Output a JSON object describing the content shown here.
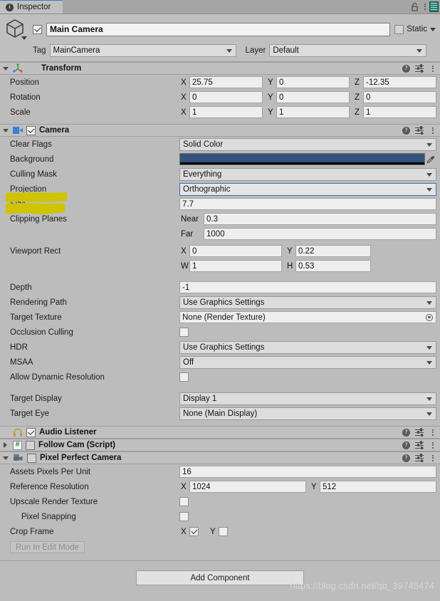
{
  "window": {
    "tab_label": "Inspector",
    "tab_icon": "info-icon",
    "lock_icon": "lock-icon",
    "menu_icon": "kebab-menu-icon",
    "layers_icon": "layers-icon"
  },
  "gameobject": {
    "icon": "cube-icon",
    "enabled": true,
    "name": "Main Camera",
    "static_label": "Static",
    "static_checked": false,
    "tag_label": "Tag",
    "tag_value": "MainCamera",
    "layer_label": "Layer",
    "layer_value": "Default"
  },
  "components": [
    {
      "title": "Transform",
      "icon": "transform-axis-icon",
      "expanded": true,
      "has_toggle": false,
      "help_icon": "help-icon",
      "preset_icon": "preset-settings-icon",
      "menu_icon": "kebab-menu-icon",
      "rows": [
        {
          "name": "Position",
          "x": "25.75",
          "y": "0",
          "z": "-12.35"
        },
        {
          "name": "Rotation",
          "x": "0",
          "y": "0",
          "z": "0"
        },
        {
          "name": "Scale",
          "x": "1",
          "y": "1",
          "z": "1"
        }
      ],
      "axis_labels": {
        "x": "X",
        "y": "Y",
        "z": "Z"
      }
    },
    {
      "title": "Camera",
      "icon": "camera-icon",
      "expanded": true,
      "has_toggle": true,
      "enabled": true,
      "properties": {
        "clear_flags_label": "Clear Flags",
        "clear_flags_value": "Solid Color",
        "background_label": "Background",
        "background_color": "#34527e",
        "background_alpha_color": "#000000",
        "eyedropper_icon": "eyedropper-icon",
        "culling_mask_label": "Culling Mask",
        "culling_mask_value": "Everything",
        "projection_label": "Projection",
        "projection_value": "Orthographic",
        "size_label": "Size",
        "size_value": "7.7",
        "clipping_planes_label": "Clipping Planes",
        "near_label": "Near",
        "near_value": "0.3",
        "far_label": "Far",
        "far_value": "1000",
        "viewport_rect_label": "Viewport Rect",
        "viewport_x_label": "X",
        "viewport_x_value": "0",
        "viewport_y_label": "Y",
        "viewport_y_value": "0.22",
        "viewport_w_label": "W",
        "viewport_w_value": "1",
        "viewport_h_label": "H",
        "viewport_h_value": "0.53",
        "depth_label": "Depth",
        "depth_value": "-1",
        "rendering_path_label": "Rendering Path",
        "rendering_path_value": "Use Graphics Settings",
        "target_texture_label": "Target Texture",
        "target_texture_value": "None (Render Texture)",
        "target_texture_picker_icon": "object-picker-icon",
        "occlusion_culling_label": "Occlusion Culling",
        "occlusion_culling_checked": false,
        "hdr_label": "HDR",
        "hdr_value": "Use Graphics Settings",
        "msaa_label": "MSAA",
        "msaa_value": "Off",
        "allow_dynamic_resolution_label": "Allow Dynamic Resolution",
        "allow_dynamic_resolution_checked": false,
        "target_display_label": "Target Display",
        "target_display_value": "Display 1",
        "target_eye_label": "Target Eye",
        "target_eye_value": "None (Main Display)"
      }
    },
    {
      "title": "Audio Listener",
      "icon": "headphones-icon",
      "expanded": false,
      "has_toggle": true,
      "enabled": true,
      "show_foldout": false
    },
    {
      "title": "Follow Cam (Script)",
      "icon": "script-icon",
      "icon_glyph": "#",
      "expanded": false,
      "has_toggle": true,
      "enabled": false
    },
    {
      "title": "Pixel Perfect Camera",
      "icon": "pixel-perfect-camera-icon",
      "expanded": true,
      "has_toggle": true,
      "enabled": false,
      "properties": {
        "assets_ppu_label": "Assets Pixels Per Unit",
        "assets_ppu_value": "16",
        "reference_resolution_label": "Reference Resolution",
        "ref_x_label": "X",
        "ref_x_value": "1024",
        "ref_y_label": "Y",
        "ref_y_value": "512",
        "upscale_render_texture_label": "Upscale Render Texture",
        "upscale_render_texture_checked": false,
        "pixel_snapping_label": "Pixel Snapping",
        "pixel_snapping_checked": false,
        "crop_frame_label": "Crop Frame",
        "crop_x_label": "X",
        "crop_x_checked": true,
        "crop_y_label": "Y",
        "crop_y_checked": false,
        "run_in_edit_mode_label": "Run In Edit Mode"
      }
    }
  ],
  "footer": {
    "add_component_label": "Add Component",
    "watermark": "https://blog.csdn.net/qq_39745474"
  },
  "annotations": {
    "highlight_color": "#cfc400",
    "highlighted_labels": [
      "Projection",
      "Size"
    ]
  }
}
